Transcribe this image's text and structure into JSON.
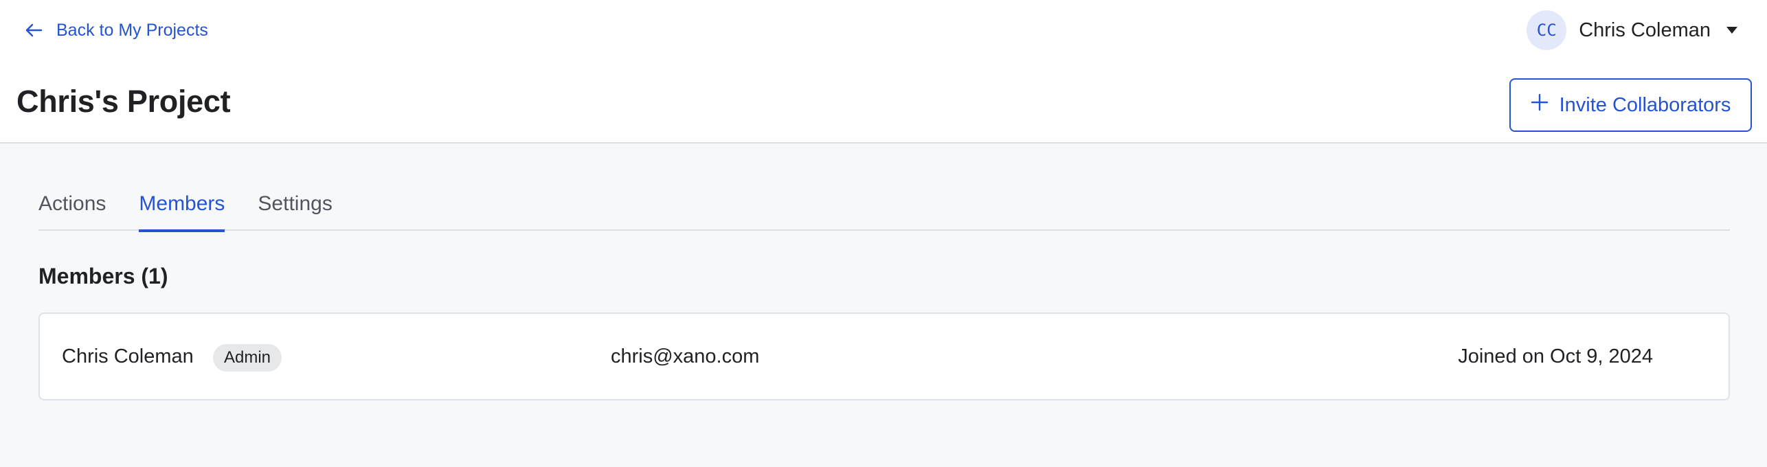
{
  "header": {
    "back_link": {
      "label": "Back to My Projects",
      "icon": "arrow-left-icon"
    },
    "user": {
      "initials": "CC",
      "name": "Chris Coleman",
      "menu_icon": "caret-down-icon"
    },
    "title": "Chris's Project",
    "invite_button": {
      "label": "Invite Collaborators",
      "icon": "plus-icon"
    }
  },
  "tabs": [
    {
      "label": "Actions",
      "active": false
    },
    {
      "label": "Members",
      "active": true
    },
    {
      "label": "Settings",
      "active": false
    }
  ],
  "members_section": {
    "title": "Members (1)",
    "members": [
      {
        "name": "Chris Coleman",
        "role": "Admin",
        "email": "chris@xano.com",
        "joined": "Joined on Oct 9, 2024"
      }
    ]
  },
  "colors": {
    "accent": "#2553d1",
    "page_background": "#f7f8fa",
    "header_background": "#ffffff",
    "badge_background": "#e7e8ea",
    "avatar_background": "#e3e9fb"
  }
}
